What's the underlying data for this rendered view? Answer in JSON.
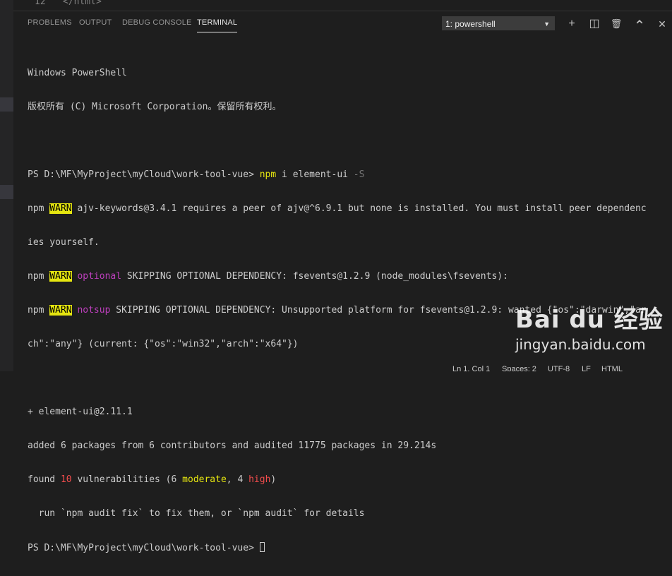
{
  "editor": {
    "line_number": "12",
    "code": "</html>"
  },
  "panel": {
    "tabs": [
      {
        "label": "PROBLEMS"
      },
      {
        "label": "OUTPUT"
      },
      {
        "label": "DEBUG CONSOLE"
      },
      {
        "label": "TERMINAL"
      }
    ],
    "active_tab": "TERMINAL",
    "terminal_select": {
      "selected": "1: powershell"
    },
    "actions": [
      {
        "icon": "plus-icon",
        "glyph": "+"
      },
      {
        "icon": "split-terminal-icon",
        "glyph": "◫"
      },
      {
        "icon": "trash-icon",
        "glyph": "🗑"
      },
      {
        "icon": "chevron-up-icon",
        "glyph": "⌃"
      },
      {
        "icon": "close-icon",
        "glyph": "✕"
      }
    ]
  },
  "terminal": {
    "header1": "Windows PowerShell",
    "header2": "版权所有 (C) Microsoft Corporation。保留所有权利。",
    "prompt": "PS D:\\MF\\MyProject\\myCloud\\work-tool-vue>",
    "command": "npm",
    "command_args": "i element-ui",
    "command_flag": "-S",
    "npm": "npm",
    "warn": "WARN",
    "warn1_text": " ajv-keywords@3.4.1 requires a peer of ajv@^6.9.1 but none is installed. You must install peer dependenc",
    "warn1_cont": "ies yourself.",
    "optional": "optional",
    "warn2_text": " SKIPPING OPTIONAL DEPENDENCY: fsevents@1.2.9 (node_modules\\fsevents):",
    "notsup": "notsup",
    "warn3_text": " SKIPPING OPTIONAL DEPENDENCY: Unsupported platform for fsevents@1.2.9: wanted {\"os\":\"darwin\",\"ar",
    "warn3_cont": "ch\":\"any\"} (current: {\"os\":\"win32\",\"arch\":\"x64\"})",
    "installed": "+ element-ui@2.11.1",
    "added": "added 6 packages from 6 contributors and audited 11775 packages in 29.214s",
    "found_pre": "found ",
    "vuln_count": "10",
    "found_mid": " vulnerabilities (6 ",
    "moderate": "moderate",
    "found_comma": ", 4 ",
    "high": "high",
    "found_end": ")",
    "run_hint": "  run `npm audit fix` to fix them, or `npm audit` for details",
    "prompt2": "PS D:\\MF\\MyProject\\myCloud\\work-tool-vue>"
  },
  "statusbar": {
    "position": "Ln 1, Col 1",
    "spaces": "Spaces: 2",
    "encoding": "UTF-8",
    "eol": "LF",
    "language": "HTML"
  },
  "watermark": {
    "logo": "Bai du 经验",
    "url": "jingyan.baidu.com"
  },
  "colors": {
    "background": "#1e1e1e",
    "warn_bg": "#e5e510",
    "optional": "#bc3fbc",
    "high": "#f14c4c",
    "moderate": "#e5e510"
  }
}
